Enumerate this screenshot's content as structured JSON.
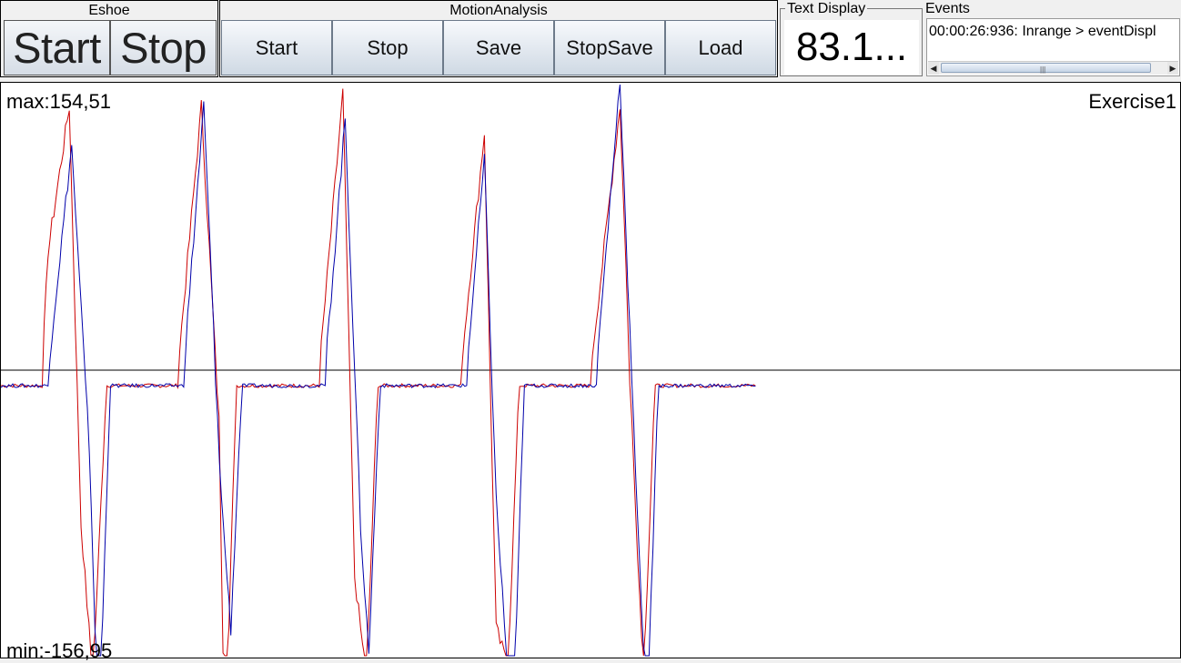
{
  "eshoe": {
    "title": "Eshoe",
    "start_label": "Start",
    "stop_label": "Stop"
  },
  "motion": {
    "title": "MotionAnalysis",
    "buttons": [
      "Start",
      "Stop",
      "Save",
      "StopSave",
      "Load"
    ]
  },
  "text_display": {
    "legend": "Text Display",
    "value": "83.1..."
  },
  "events": {
    "legend": "Events",
    "line": "00:00:26:936: Inrange > eventDispl"
  },
  "chart": {
    "max_label": "max:154,51",
    "min_label": "min:-156,95",
    "exercise_label": "Exercise1"
  },
  "colors": {
    "series1": "#cc0000",
    "series2": "#0000aa"
  },
  "chart_data": {
    "type": "line",
    "max": 154.51,
    "min": -156.95,
    "series": [
      {
        "color": "#cc0000",
        "key_points": [
          [
            0,
            0
          ],
          [
            0.035,
            0
          ],
          [
            0.04,
            0.45
          ],
          [
            0.058,
            1.0
          ],
          [
            0.068,
            -0.6
          ],
          [
            0.078,
            -1.2
          ],
          [
            0.09,
            0
          ],
          [
            0.15,
            0
          ],
          [
            0.17,
            1.0
          ],
          [
            0.185,
            -0.2
          ],
          [
            0.19,
            -1.5
          ],
          [
            0.2,
            0
          ],
          [
            0.27,
            0
          ],
          [
            0.29,
            1.05
          ],
          [
            0.3,
            -0.8
          ],
          [
            0.31,
            -1.2
          ],
          [
            0.32,
            0
          ],
          [
            0.39,
            0
          ],
          [
            0.41,
            0.9
          ],
          [
            0.42,
            -1.0
          ],
          [
            0.43,
            -1.15
          ],
          [
            0.44,
            0
          ],
          [
            0.5,
            0
          ],
          [
            0.525,
            1.0
          ],
          [
            0.535,
            -0.2
          ],
          [
            0.545,
            -1.2
          ],
          [
            0.555,
            0
          ],
          [
            0.64,
            0
          ]
        ]
      },
      {
        "color": "#0000aa",
        "key_points": [
          [
            0,
            0
          ],
          [
            0.04,
            0
          ],
          [
            0.06,
            0.85
          ],
          [
            0.075,
            -0.3
          ],
          [
            0.083,
            -1.45
          ],
          [
            0.093,
            0
          ],
          [
            0.155,
            0
          ],
          [
            0.172,
            1.0
          ],
          [
            0.187,
            -0.5
          ],
          [
            0.195,
            -1.0
          ],
          [
            0.205,
            0
          ],
          [
            0.275,
            0
          ],
          [
            0.292,
            0.95
          ],
          [
            0.305,
            -0.6
          ],
          [
            0.312,
            -1.1
          ],
          [
            0.322,
            0
          ],
          [
            0.395,
            0
          ],
          [
            0.41,
            0.8
          ],
          [
            0.42,
            -0.5
          ],
          [
            0.434,
            -1.46
          ],
          [
            0.444,
            0
          ],
          [
            0.505,
            0
          ],
          [
            0.525,
            1.1
          ],
          [
            0.54,
            -0.6
          ],
          [
            0.548,
            -1.35
          ],
          [
            0.558,
            0
          ],
          [
            0.64,
            0
          ]
        ]
      }
    ]
  }
}
